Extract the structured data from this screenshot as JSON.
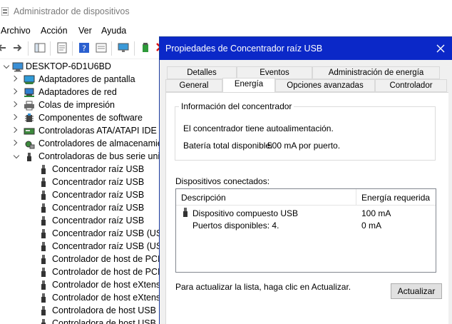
{
  "main_window": {
    "title": "Administrador de dispositivos",
    "menu": [
      "Archivo",
      "Acción",
      "Ver",
      "Ayuda"
    ]
  },
  "tree": {
    "root": "DESKTOP-6D1U6BD",
    "categories": [
      "Adaptadores de pantalla",
      "Adaptadores de red",
      "Colas de impresión",
      "Componentes de software",
      "Controladoras ATA/ATAPI IDE",
      "Controladores de almacenamiento",
      "Controladoras de bus serie universal"
    ],
    "usb_children": [
      "Concentrador raíz USB",
      "Concentrador raíz USB",
      "Concentrador raíz USB",
      "Concentrador raíz USB",
      "Concentrador raíz USB",
      "Concentrador raíz USB (USB",
      "Concentrador raíz USB (USB",
      "Controlador de host de PCI a",
      "Controlador de host de PCI a",
      "Controlador de host eXtensib",
      "Controlador de host eXtensib",
      "Controladora de host USB Op",
      "Controladora de host USB Op"
    ]
  },
  "dialog": {
    "title": "Propiedades de Concentrador raíz USB",
    "tabs_back": [
      "Detalles",
      "Eventos",
      "Administración de energía"
    ],
    "tabs_front": [
      "General",
      "Energía",
      "Opciones avanzadas",
      "Controlador"
    ],
    "active_tab": "Energía",
    "hub_info": {
      "label": "Información del concentrador",
      "self_powered": "El concentrador tiene autoalimentación.",
      "total_power_label": "Batería total disponible:",
      "total_power_value": "500 mA por puerto."
    },
    "connected": {
      "label": "Dispositivos conectados:",
      "col_description": "Descripción",
      "col_power": "Energía requerida",
      "rows": [
        {
          "description": "Dispositivo compuesto USB",
          "power": "100 mA"
        },
        {
          "description": "Puertos disponibles: 4.",
          "power": "0 mA"
        }
      ]
    },
    "hint": "Para actualizar la lista, haga clic en Actualizar.",
    "update_button": "Actualizar"
  },
  "colors": {
    "dialog_titlebar": "#0b28c8",
    "dialog_background": "#f0f0f0"
  }
}
